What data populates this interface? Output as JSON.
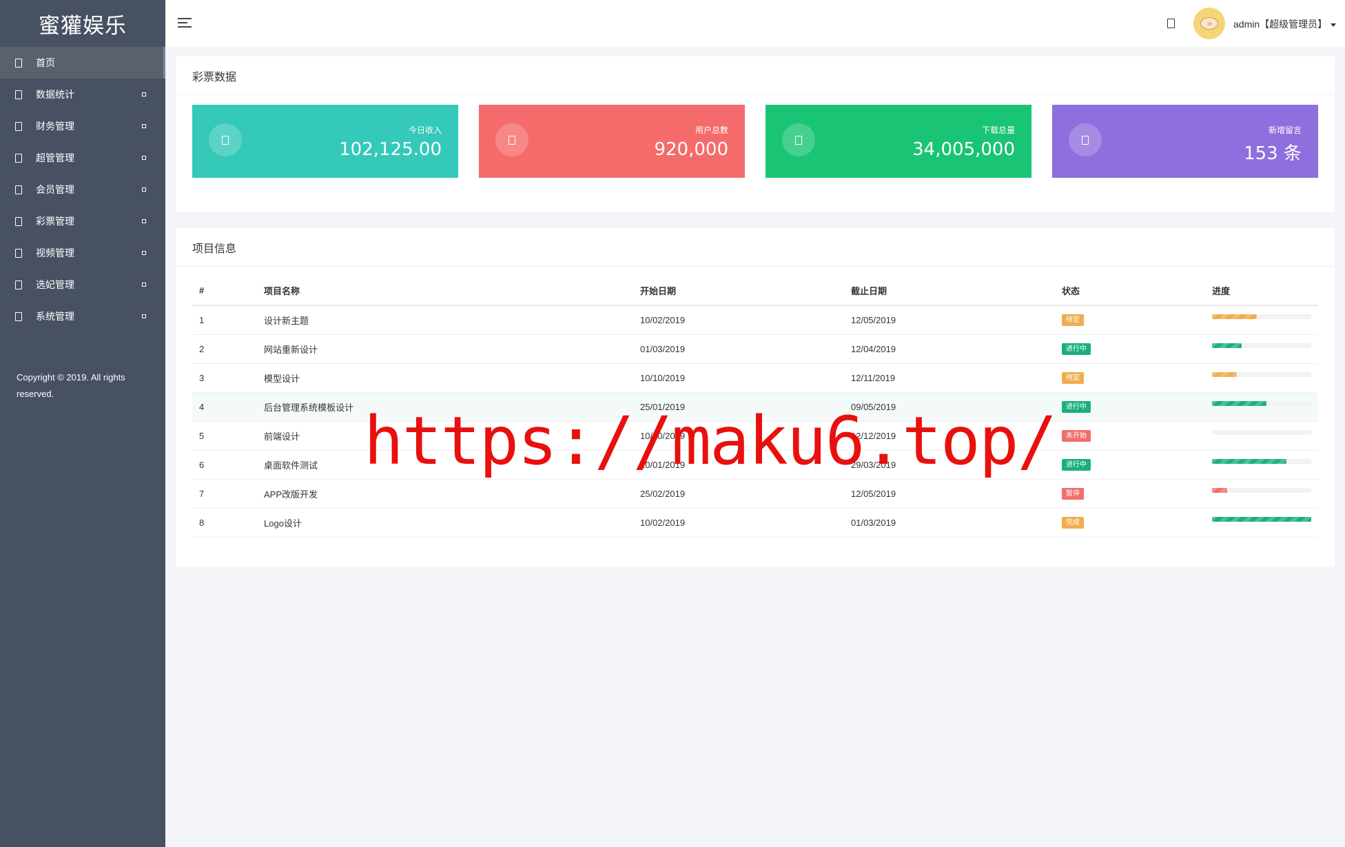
{
  "app": {
    "brand": "蜜獾娱乐"
  },
  "sidebar": {
    "items": [
      {
        "label": "首页",
        "active": true,
        "has_arrow": false
      },
      {
        "label": "数据统计",
        "active": false,
        "has_arrow": true
      },
      {
        "label": "财务管理",
        "active": false,
        "has_arrow": true
      },
      {
        "label": "超管管理",
        "active": false,
        "has_arrow": true
      },
      {
        "label": "会员管理",
        "active": false,
        "has_arrow": true
      },
      {
        "label": "彩票管理",
        "active": false,
        "has_arrow": true
      },
      {
        "label": "视频管理",
        "active": false,
        "has_arrow": true
      },
      {
        "label": "选妃管理",
        "active": false,
        "has_arrow": true
      },
      {
        "label": "系统管理",
        "active": false,
        "has_arrow": true
      }
    ],
    "copyright": "Copyright © 2019. All rights reserved."
  },
  "header": {
    "user": "admin【超级管理员】"
  },
  "stats_panel": {
    "title": "彩票数据",
    "cards": [
      {
        "label": "今日收入",
        "value": "102,125.00",
        "color": "#34c9b8"
      },
      {
        "label": "用户总数",
        "value": "920,000",
        "color": "#f56b6b"
      },
      {
        "label": "下载总量",
        "value": "34,005,000",
        "color": "#1ac475"
      },
      {
        "label": "新增留言",
        "value": "153 条",
        "color": "#8f6edd"
      }
    ]
  },
  "projects_panel": {
    "title": "项目信息",
    "columns": [
      "#",
      "项目名称",
      "开始日期",
      "截止日期",
      "状态",
      "进度"
    ],
    "rows": [
      {
        "id": "1",
        "name": "设计新主题",
        "start": "10/02/2019",
        "end": "12/05/2019",
        "status": "待定",
        "status_color": "#f0ad4e",
        "progress": 0.45,
        "progress_color": "#f0ad4e"
      },
      {
        "id": "2",
        "name": "网站重新设计",
        "start": "01/03/2019",
        "end": "12/04/2019",
        "status": "进行中",
        "status_color": "#1ab07a",
        "progress": 0.3,
        "progress_color": "#1ab07a"
      },
      {
        "id": "3",
        "name": "模型设计",
        "start": "10/10/2019",
        "end": "12/11/2019",
        "status": "待定",
        "status_color": "#f0ad4e",
        "progress": 0.25,
        "progress_color": "#f0ad4e"
      },
      {
        "id": "4",
        "name": "后台管理系统模板设计",
        "start": "25/01/2019",
        "end": "09/05/2019",
        "status": "进行中",
        "status_color": "#1ab07a",
        "progress": 0.55,
        "progress_color": "#1ab07a"
      },
      {
        "id": "5",
        "name": "前端设计",
        "start": "10/10/2019",
        "end": "12/12/2019",
        "status": "未开始",
        "status_color": "#ef6f6c",
        "progress": 0.0,
        "progress_color": "#ef6f6c"
      },
      {
        "id": "6",
        "name": "桌面软件测试",
        "start": "10/01/2019",
        "end": "29/03/2019",
        "status": "进行中",
        "status_color": "#1ab07a",
        "progress": 0.75,
        "progress_color": "#1ab07a"
      },
      {
        "id": "7",
        "name": "APP改版开发",
        "start": "25/02/2019",
        "end": "12/05/2019",
        "status": "暂停",
        "status_color": "#ef6f6c",
        "progress": 0.15,
        "progress_color": "#ef6f6c"
      },
      {
        "id": "8",
        "name": "Logo设计",
        "start": "10/02/2019",
        "end": "01/03/2019",
        "status": "完成",
        "status_color": "#f0ad4e",
        "progress": 1.0,
        "progress_color": "#1ab07a"
      }
    ]
  },
  "watermark": "https://maku6.top/",
  "icons": {
    "menu": "hamburger-icon",
    "notification": "bell-icon",
    "nav": "page-icon",
    "stat": "page-icon"
  }
}
